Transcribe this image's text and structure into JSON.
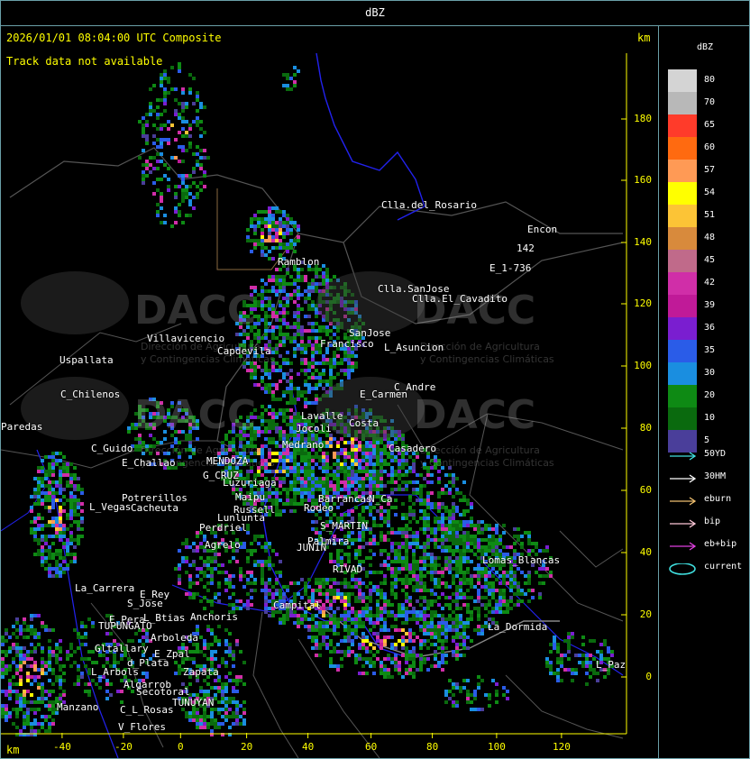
{
  "title": "dBZ",
  "header": {
    "timestamp": "2026/01/01 08:04:00 UTC Composite",
    "track_status": "Track data not available",
    "unit_top": "km",
    "unit_bottom": "km"
  },
  "axes": {
    "y_ticks": [
      "180",
      "160",
      "140",
      "120",
      "100",
      "80",
      "60",
      "40",
      "20",
      "0"
    ],
    "x_ticks": [
      "-40",
      "-20",
      "0",
      "20",
      "40",
      "60",
      "80",
      "100",
      "120"
    ]
  },
  "watermark": {
    "brand": "DACC",
    "line1": "Dirección de Agricultura",
    "line2": "y Contingencias Climáticas"
  },
  "places": [
    "Clla.del_Rosario",
    "Encon",
    "142",
    "E_1-736",
    "Ramblon",
    "Clla.SanJose",
    "Clla.El_Cavadito",
    "SanJose",
    "Villavicencio",
    "Francisco",
    "L_Asuncion",
    "Capdevila",
    "Uspallata",
    "C_Andre",
    "E_Carmen",
    "C_Chilenos",
    "Lavalle",
    "Paredas",
    "Costa",
    "Jocoli",
    "Casadero",
    "C_Guido",
    "E_Challao",
    "MENDOZA",
    "G_CRUZ",
    "Luzuriaga",
    "Potrerillos",
    "Cacheuta",
    "L_Vegas",
    "Maipu",
    "Russell",
    "Perdriel",
    "Lunlunta",
    "Agrelo",
    "S_MARTIN",
    "JUNIN",
    "RIVAD",
    "Lomas_Blancas",
    "La_Carrera",
    "E_Rey",
    "S_Jose",
    "Campital",
    "E_Pera",
    "TUPUNGATO",
    "L_Btias",
    "Anchoris",
    "Arboleda",
    "Gltallary",
    "E_Zpal",
    "L_Arbols",
    "d_Plata",
    "Zapata",
    "Algarrob",
    "Secotoral",
    "Manzano",
    "TUNUYAN",
    "C_L_Rosas",
    "V_Flores",
    "L_Paz",
    "La_Dormida",
    "Palmira",
    "Rodeo",
    "Barrancas",
    "Medrano",
    "N_Ca"
  ],
  "legend": {
    "title": "dBZ",
    "scale": [
      {
        "label": "80",
        "color": "#d4d4d4"
      },
      {
        "label": "70",
        "color": "#b8b8b8"
      },
      {
        "label": "65",
        "color": "#ff3b2a"
      },
      {
        "label": "60",
        "color": "#ff6a10"
      },
      {
        "label": "57",
        "color": "#ff9a55"
      },
      {
        "label": "54",
        "color": "#ffff00"
      },
      {
        "label": "51",
        "color": "#fcc436"
      },
      {
        "label": "48",
        "color": "#d88a3c"
      },
      {
        "label": "45",
        "color": "#c06a8a"
      },
      {
        "label": "42",
        "color": "#d02ea8"
      },
      {
        "label": "39",
        "color": "#c01a98"
      },
      {
        "label": "36",
        "color": "#7a1ed0"
      },
      {
        "label": "35",
        "color": "#2a5ce8"
      },
      {
        "label": "30",
        "color": "#1a8ee0"
      },
      {
        "label": "20",
        "color": "#0e8a14"
      },
      {
        "label": "10",
        "color": "#0a6a0e"
      },
      {
        "label": "5",
        "color": "#4a3e9a"
      }
    ],
    "tracks": [
      {
        "label": "50YD",
        "color": "#40e0e0"
      },
      {
        "label": "30HM",
        "color": "#ffffff"
      },
      {
        "label": "eburn",
        "color": "#f0c070"
      },
      {
        "label": "bip",
        "color": "#ffc8d8"
      },
      {
        "label": "eb+bip",
        "color": "#e040e0"
      },
      {
        "label": "current",
        "color": "#40e0e0"
      }
    ]
  }
}
